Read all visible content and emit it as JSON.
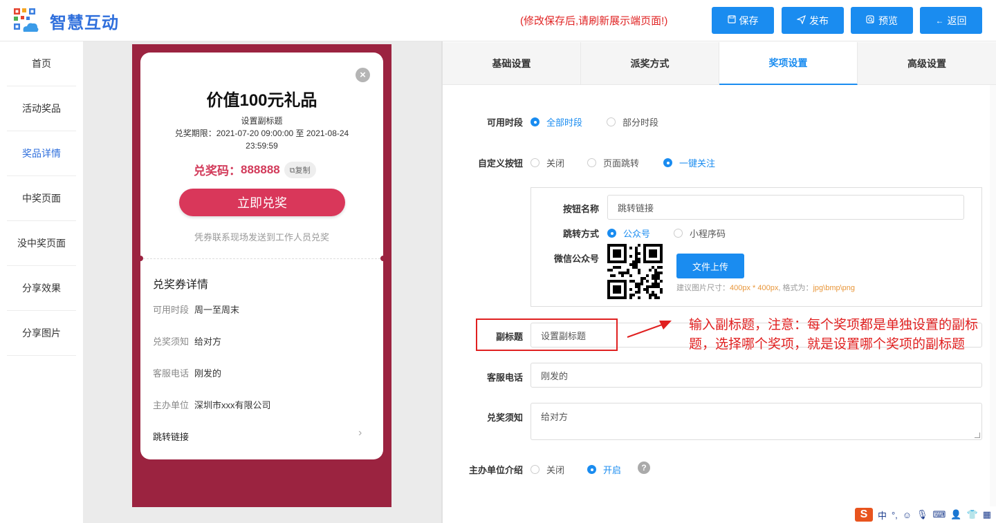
{
  "header": {
    "brand": "智慧互动",
    "notice": "(修改保存后,请刷新展示端页面!)",
    "buttons": [
      {
        "label": "保存",
        "icon": "save-icon"
      },
      {
        "label": "发布",
        "icon": "send-icon"
      },
      {
        "label": "预览",
        "icon": "preview-icon"
      },
      {
        "label": "返回",
        "icon": "back-arrow-icon"
      }
    ]
  },
  "sidebar": {
    "items": [
      "首页",
      "活动奖品",
      "奖品详情",
      "中奖页面",
      "没中奖页面",
      "分享效果",
      "分享图片"
    ],
    "active_index": 2
  },
  "preview": {
    "title": "价值100元礼品",
    "subtitle": "设置副标题",
    "period": "兑奖期限：2021-07-20 09:00:00 至 2021-08-24 23:59:59",
    "code_label": "兑奖码：",
    "code_value": "888888",
    "copy_label": "复制",
    "redeem_button": "立即兑奖",
    "redeem_hint": "凭券联系现场发送到工作人员兑奖",
    "details_title": "兑奖券详情",
    "details": [
      {
        "key": "可用时段",
        "value": "周一至周末"
      },
      {
        "key": "兑奖须知",
        "value": "给对方"
      },
      {
        "key": "客服电话",
        "value": "刚发的"
      },
      {
        "key": "主办单位",
        "value": "深圳市xxx有限公司"
      }
    ],
    "jump_link": "跳转链接"
  },
  "tabs": [
    "基础设置",
    "派奖方式",
    "奖项设置",
    "高级设置"
  ],
  "active_tab": 2,
  "form": {
    "available_time": {
      "label": "可用时段",
      "options": [
        "全部时段",
        "部分时段"
      ],
      "selected": 0
    },
    "custom_button": {
      "label": "自定义按钮",
      "options": [
        "关闭",
        "页面跳转",
        "一键关注"
      ],
      "selected": 2
    },
    "button_name": {
      "label": "按钮名称",
      "value": "跳转链接"
    },
    "jump_mode": {
      "label": "跳转方式",
      "options": [
        "公众号",
        "小程序码"
      ],
      "selected": 0
    },
    "wechat_account": {
      "label": "微信公众号"
    },
    "upload": {
      "button": "文件上传",
      "hint_prefix": "建议图片尺寸：",
      "hint_size": "400px * 400px",
      "hint_mid": ", 格式为：",
      "hint_format": "jpg\\bmp\\png"
    },
    "subtitle": {
      "label": "副标题",
      "value": "设置副标题"
    },
    "phone": {
      "label": "客服电话",
      "value": "刚发的"
    },
    "notice": {
      "label": "兑奖须知",
      "value": "给对方"
    },
    "organizer": {
      "label": "主办单位介绍",
      "options": [
        "关闭",
        "开启"
      ],
      "selected": 1
    }
  },
  "annotation": "输入副标题，注意：每个奖项都是单独设置的副标题，选择哪个奖项，就是设置哪个奖项的副标题",
  "ime": {
    "lang": "中",
    "punct": "°,"
  },
  "colors": {
    "primary": "#1a8cf0",
    "brand": "#2f6fdc",
    "phone_bg": "#9b2340",
    "accent_red": "#d9375a",
    "annotation": "#e02020"
  }
}
